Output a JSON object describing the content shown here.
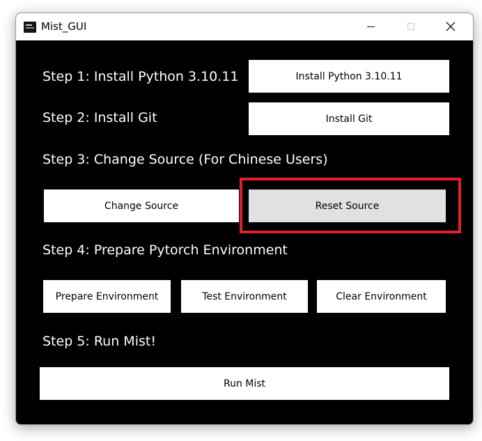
{
  "window": {
    "title": "Mist_GUI",
    "icon": "app-icon"
  },
  "steps": {
    "step1": {
      "label": "Step 1: Install Python 3.10.11",
      "button": "Install Python 3.10.11"
    },
    "step2": {
      "label": "Step 2: Install Git",
      "button": "Install Git"
    },
    "step3": {
      "label": "Step 3: Change Source (For Chinese Users)",
      "buttons": [
        "Change Source",
        "Reset Source"
      ]
    },
    "step4": {
      "label": "Step 4: Prepare Pytorch Environment",
      "buttons": [
        "Prepare Environment",
        "Test Environment",
        "Clear Environment"
      ]
    },
    "step5": {
      "label": "Step 5: Run Mist!",
      "button": "Run Mist"
    }
  },
  "colors": {
    "background": "#000000",
    "button": "#ffffff",
    "button_pressed": "#e1e1e1",
    "highlight": "#e2202c"
  }
}
